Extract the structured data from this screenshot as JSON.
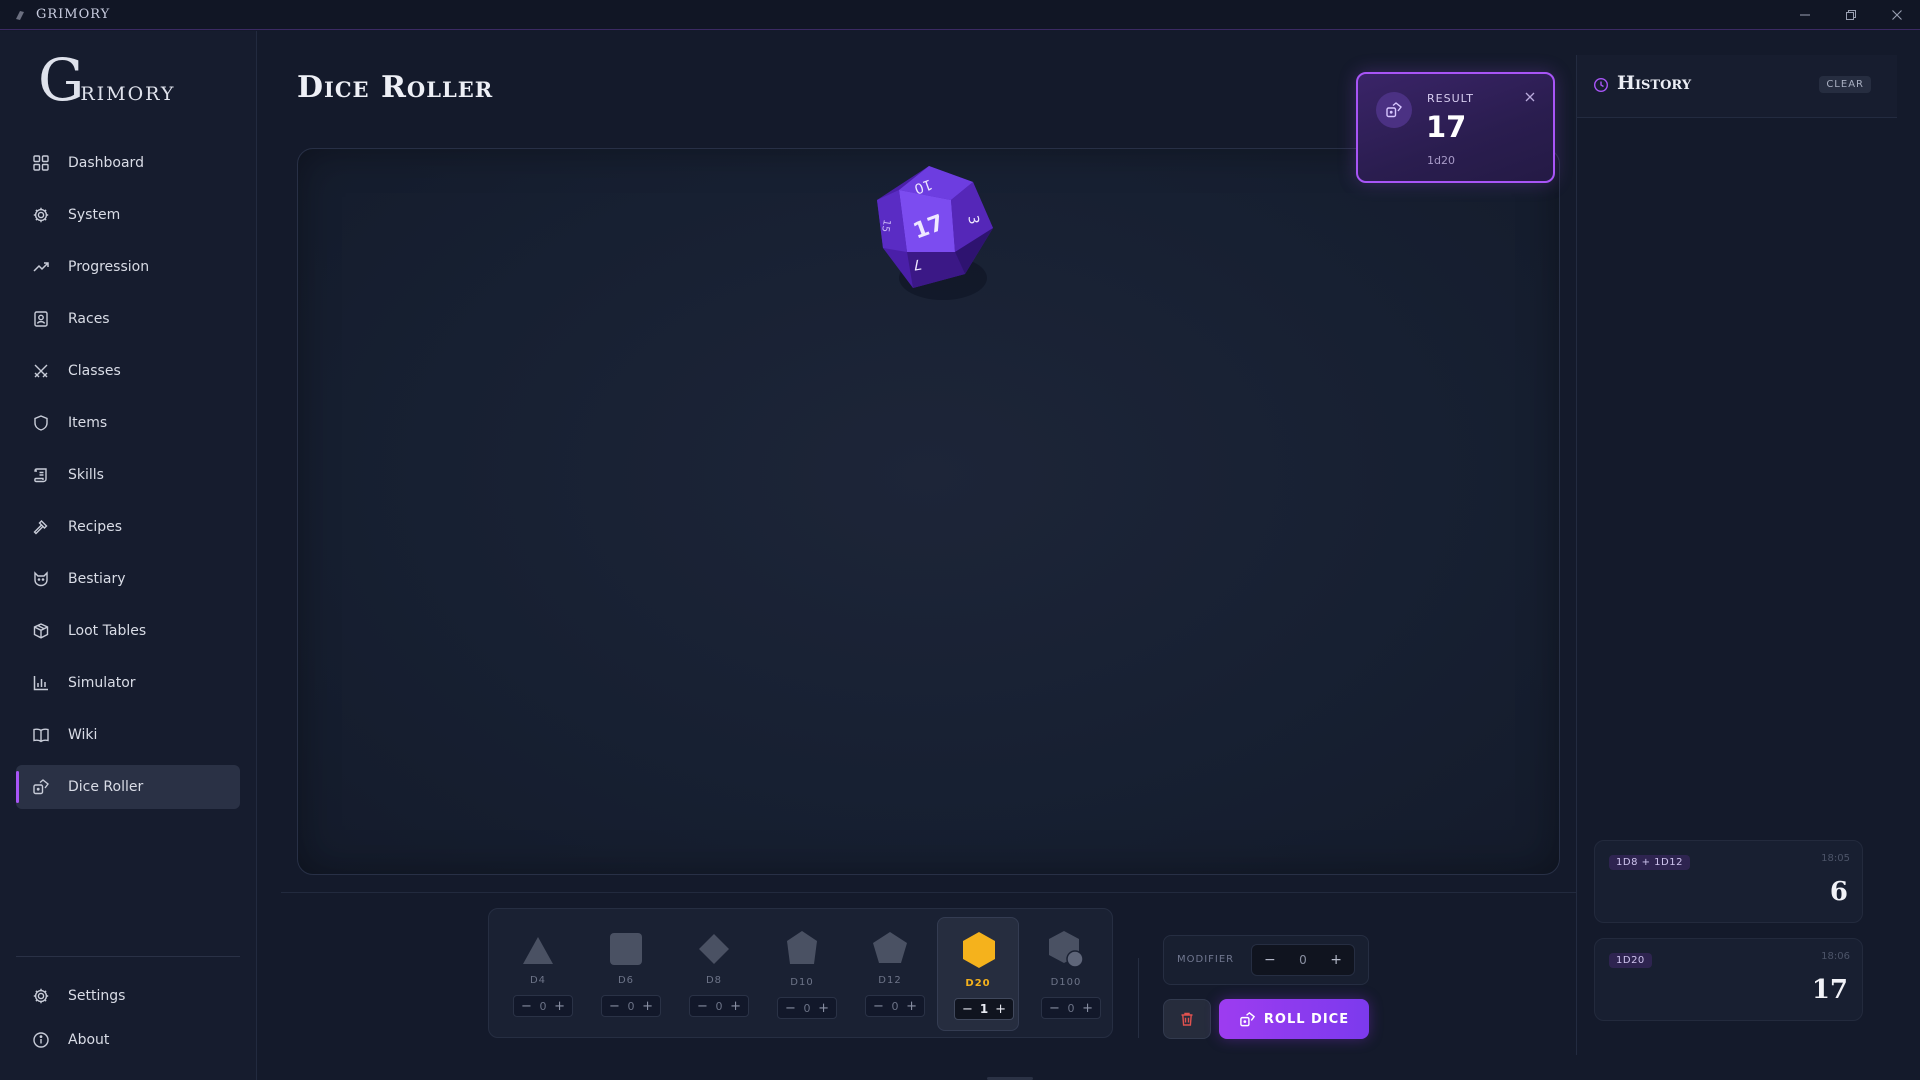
{
  "window": {
    "title": "GRIMORY",
    "controls": [
      "minimize-icon",
      "restore-icon",
      "close-icon"
    ]
  },
  "sidebar": {
    "logo_initial": "G",
    "logo_rest": "rimory",
    "items": [
      {
        "label": "Dashboard",
        "icon": "grid-icon"
      },
      {
        "label": "System",
        "icon": "gear-icon"
      },
      {
        "label": "Progression",
        "icon": "trend-icon"
      },
      {
        "label": "Races",
        "icon": "person-card-icon"
      },
      {
        "label": "Classes",
        "icon": "crossed-swords-icon"
      },
      {
        "label": "Items",
        "icon": "shield-icon"
      },
      {
        "label": "Skills",
        "icon": "scroll-icon"
      },
      {
        "label": "Recipes",
        "icon": "hammer-icon"
      },
      {
        "label": "Bestiary",
        "icon": "beast-icon"
      },
      {
        "label": "Loot Tables",
        "icon": "box-icon"
      },
      {
        "label": "Simulator",
        "icon": "bar-chart-icon"
      },
      {
        "label": "Wiki",
        "icon": "book-icon"
      },
      {
        "label": "Dice Roller",
        "icon": "dice-icon",
        "active": true
      }
    ],
    "bottom_items": [
      {
        "label": "Settings",
        "icon": "gear-icon"
      },
      {
        "label": "About",
        "icon": "info-icon"
      }
    ]
  },
  "main": {
    "title": "Dice Roller",
    "die_faces": [
      "17",
      "10",
      "3",
      "7",
      "15"
    ]
  },
  "result": {
    "label": "RESULT",
    "value": "17",
    "formula": "1d20"
  },
  "history": {
    "title": "History",
    "clear_label": "CLEAR",
    "entries": [
      {
        "formula": "1D8 + 1D12",
        "time": "18:05",
        "value": "6"
      },
      {
        "formula": "1D20",
        "time": "18:06",
        "value": "17"
      }
    ]
  },
  "dice": [
    {
      "label": "D4",
      "count": "0",
      "selected": false
    },
    {
      "label": "D6",
      "count": "0",
      "selected": false
    },
    {
      "label": "D8",
      "count": "0",
      "selected": false
    },
    {
      "label": "D10",
      "count": "0",
      "selected": false
    },
    {
      "label": "D12",
      "count": "0",
      "selected": false
    },
    {
      "label": "D20",
      "count": "1",
      "selected": true
    },
    {
      "label": "D100",
      "count": "0",
      "selected": false
    }
  ],
  "modifier": {
    "label": "MODIFIER",
    "value": "0"
  },
  "actions": {
    "roll_label": "ROLL DICE"
  },
  "colors": {
    "accent": "#a855f7",
    "selected_die": "#f5b21c",
    "background": "#141a2b"
  }
}
